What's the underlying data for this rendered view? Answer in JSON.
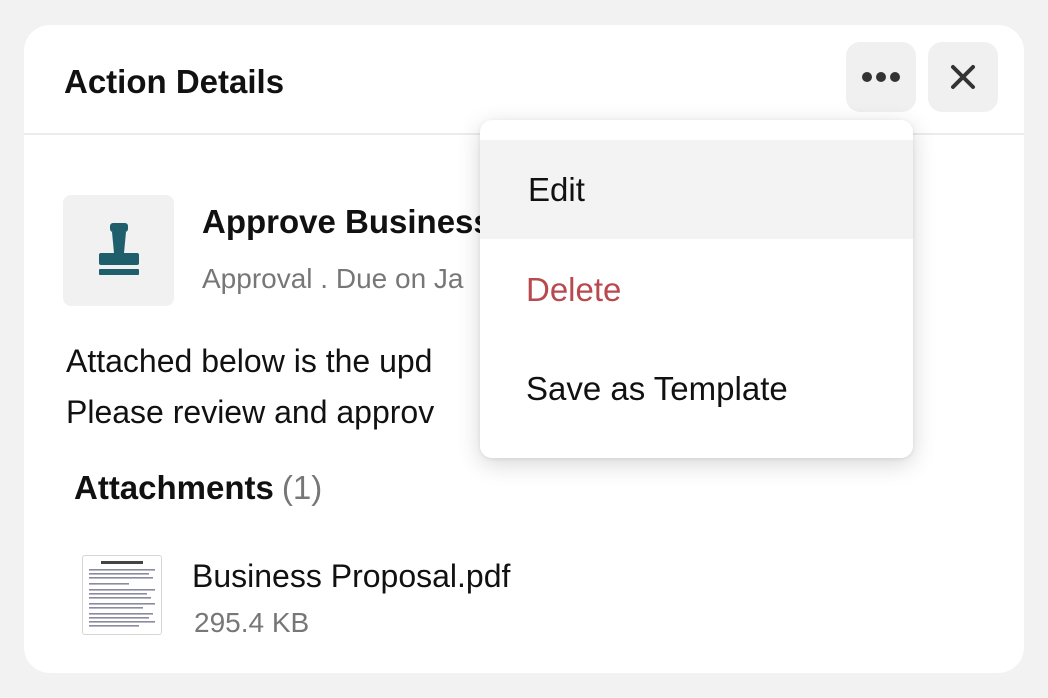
{
  "header": {
    "title": "Action Details",
    "more_icon": "more-horizontal-icon",
    "close_icon": "close-icon"
  },
  "action": {
    "icon": "stamp-icon",
    "icon_color": "#1f5f6b",
    "title": "Approve Business",
    "subtitle": "Approval . Due on Ja"
  },
  "description": {
    "line1": "Attached below is the upd",
    "line2": "Please review and approv"
  },
  "attachments": {
    "label": "Attachments",
    "count": "(1)",
    "files": [
      {
        "name": "Business Proposal.pdf",
        "size": "295.4 KB",
        "icon": "pdf-thumbnail"
      }
    ]
  },
  "menu": {
    "items": [
      {
        "label": "Edit",
        "color": "#111111",
        "highlighted": true
      },
      {
        "label": "Delete",
        "color": "#b84a4f",
        "highlighted": false
      },
      {
        "label": "Save as Template",
        "color": "#111111",
        "highlighted": false
      }
    ]
  },
  "colors": {
    "danger": "#b84a4f",
    "muted_text": "#777777",
    "button_bg": "#f0f0f0"
  }
}
